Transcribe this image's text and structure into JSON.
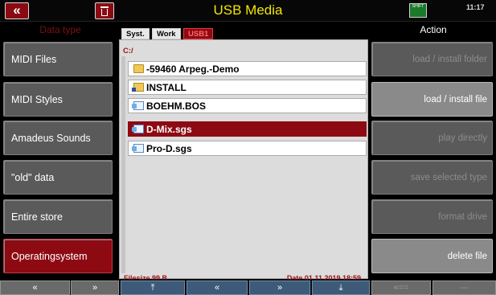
{
  "header": {
    "title": "USB Media",
    "time": "11:17",
    "back_glyph": "«",
    "keyboard_label": "SHIFT"
  },
  "left_panel": {
    "header": "Data type",
    "items": [
      {
        "label": "MIDI Files"
      },
      {
        "label": "MIDI Styles"
      },
      {
        "label": "Amadeus Sounds"
      },
      {
        "label": "\"old\" data"
      },
      {
        "label": "Entire store"
      },
      {
        "label": "Operatingsystem",
        "selected": true
      }
    ]
  },
  "browser": {
    "tabs": [
      {
        "label": "Syst."
      },
      {
        "label": "Work"
      },
      {
        "label": "USB1",
        "active": true
      }
    ],
    "path": "C:/",
    "files": [
      {
        "name": "-59460 Arpeg.-Demo",
        "icon": "folder-icon"
      },
      {
        "name": "INSTALL",
        "icon": "folder-lock-icon"
      },
      {
        "name": "BOEHM.BOS",
        "icon": "document-icon"
      },
      {
        "name": "D-Mix.sgs",
        "icon": "document-icon",
        "selected": true
      },
      {
        "name": "Pro-D.sgs",
        "icon": "document-icon"
      }
    ],
    "filesize": "Filesize  99 B",
    "date": "Date  01.11.2019   18:59"
  },
  "right_panel": {
    "header": "Action",
    "items": [
      {
        "label": "load  /  install folder"
      },
      {
        "label": "load  /  install file",
        "active": true
      },
      {
        "label": "play  directly"
      },
      {
        "label": "save  selected type"
      },
      {
        "label": "format  drive"
      },
      {
        "label": "delete  file",
        "active": true
      }
    ]
  },
  "bottom_bar": {
    "buttons": [
      {
        "label": "«"
      },
      {
        "label": "»"
      },
      {
        "label": "⤒"
      },
      {
        "label": "«"
      },
      {
        "label": "»"
      },
      {
        "label": "⤓"
      },
      {
        "label": "«=="
      },
      {
        "label": "---"
      }
    ]
  },
  "colors": {
    "accent_red": "#8e0a13",
    "title_yellow": "#f2e800",
    "panel_gray": "#5a5a5a",
    "nav_blue": "#3d5b78"
  }
}
